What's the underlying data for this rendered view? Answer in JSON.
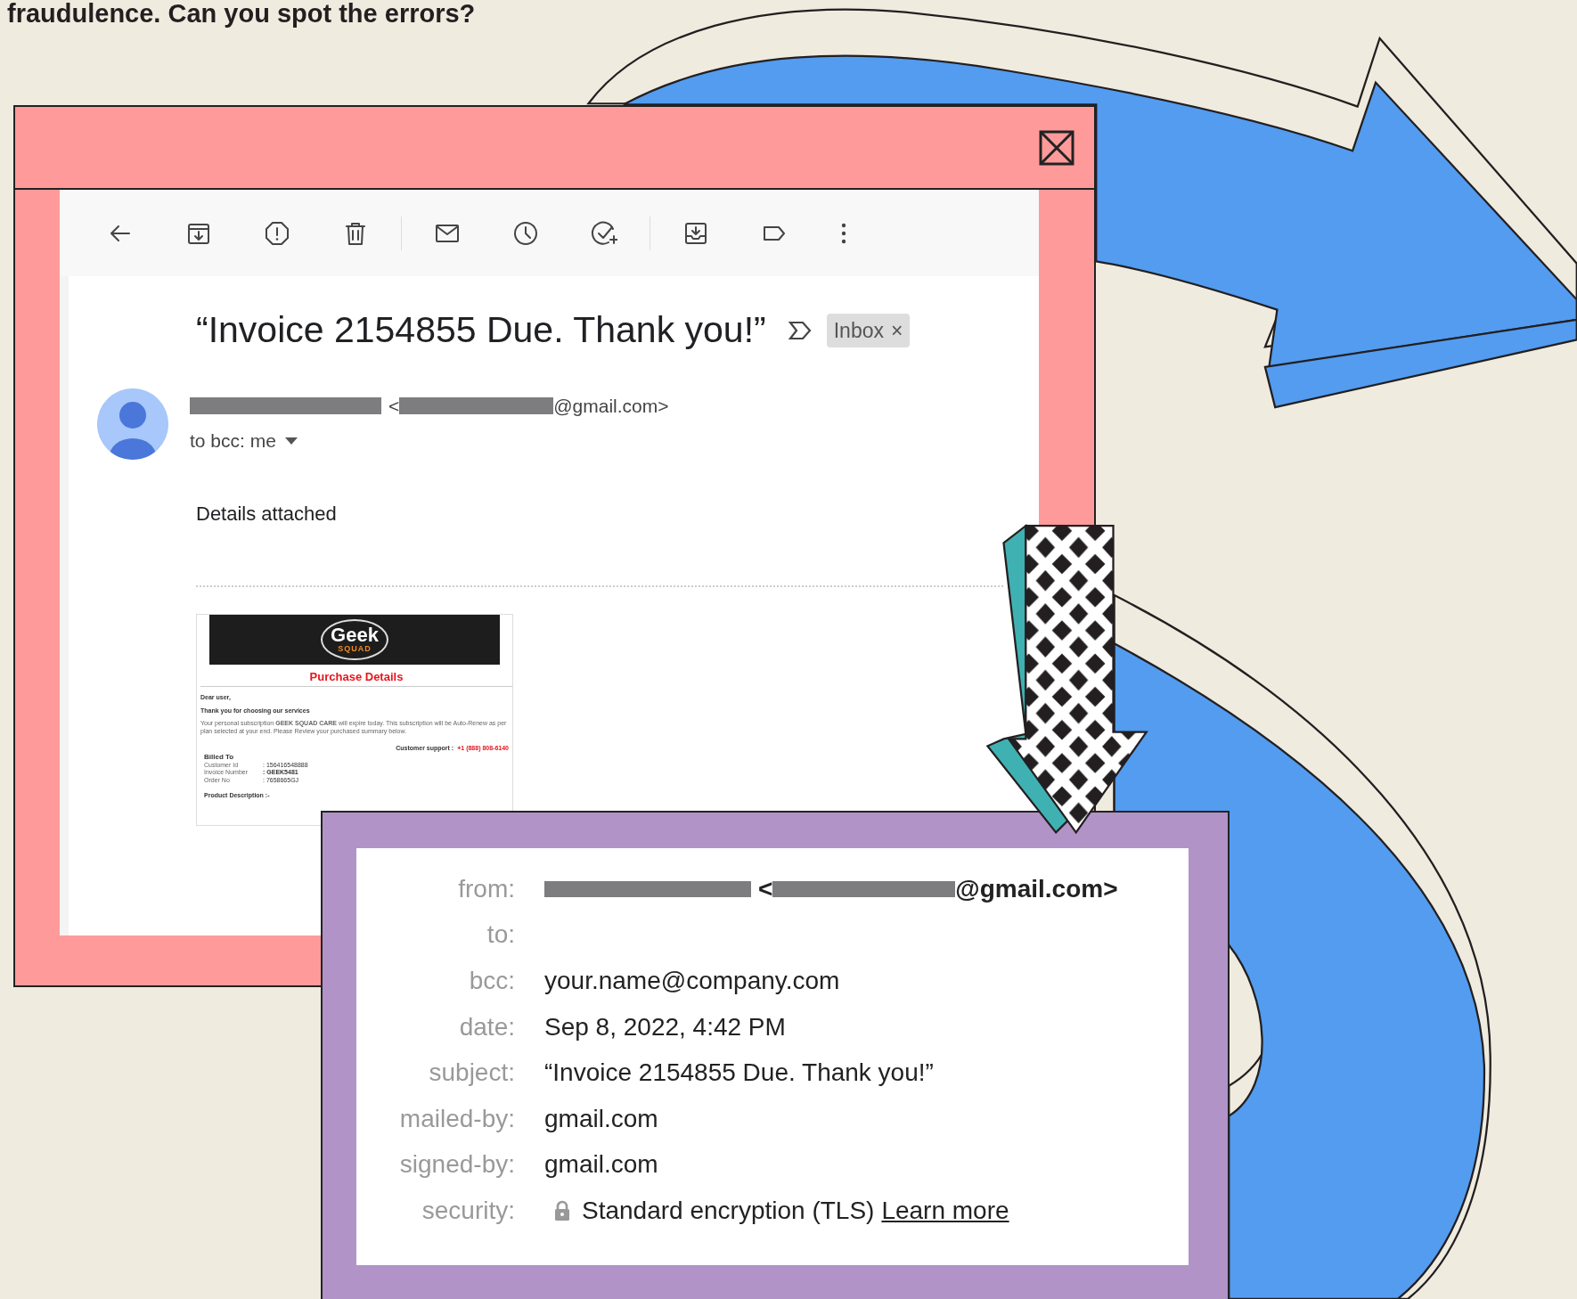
{
  "page_heading": "fraudulence. Can you spot the errors?",
  "email_window": {
    "subject": "“Invoice 2154855 Due. Thank you!”",
    "label_chip": "Inbox",
    "chip_close": "×",
    "sender_open": "<",
    "sender_tail": "@gmail.com>",
    "recipients": "to bcc: me",
    "body": "Details attached",
    "attachment": {
      "brand": "Geek",
      "brand_sub": "SQUAD",
      "title": "Purchase Details",
      "greeting": "Dear user,",
      "thanks": "Thank you for choosing our services",
      "message": "Your personal subscription **GEEK SQUAD CARE** will expire today. This subscription will be Auto-Renew as per plan selected at your end. Please Review your purchased summary below.",
      "support_label": "Customer support :",
      "support_phone": "+1 (888) 808-6140",
      "billed_to": "Billed To",
      "fields": [
        {
          "label": "Customer Id",
          "value": ": 156416548888"
        },
        {
          "label": "Invoice Number",
          "value": ": GEEK5481"
        },
        {
          "label": "Order No",
          "value": ": 7658665GJ"
        }
      ],
      "product": "Product Description :-"
    }
  },
  "details_panel": {
    "rows": [
      {
        "label": "from:",
        "kind": "sender",
        "open": "<",
        "value": "@gmail.com>"
      },
      {
        "label": "to:",
        "kind": "empty"
      },
      {
        "label": "bcc:",
        "kind": "text",
        "value": "your.name@company.com"
      },
      {
        "label": "date:",
        "kind": "text",
        "value": "Sep 8, 2022, 4:42 PM"
      },
      {
        "label": "subject:",
        "kind": "text",
        "value": "“Invoice 2154855 Due. Thank you!”"
      },
      {
        "label": "mailed-by:",
        "kind": "text",
        "value": "gmail.com"
      },
      {
        "label": "signed-by:",
        "kind": "text",
        "value": "gmail.com"
      },
      {
        "label": "security:",
        "kind": "security",
        "value": "Standard encryption (TLS)",
        "link": "Learn more"
      }
    ]
  }
}
